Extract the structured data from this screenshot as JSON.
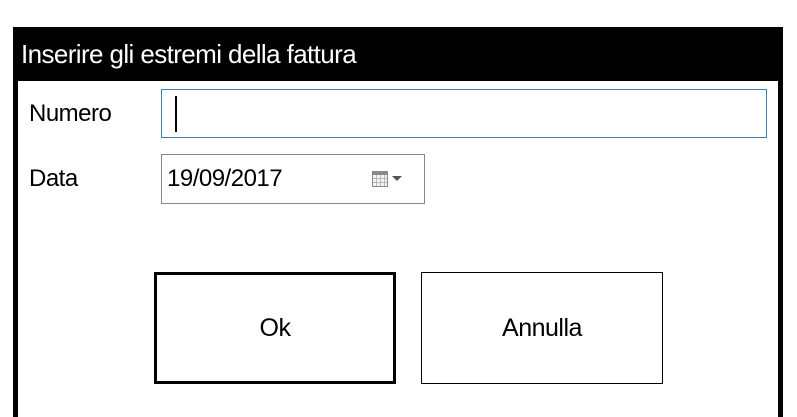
{
  "dialog": {
    "title": "Inserire gli estremi della fattura",
    "fields": {
      "numero": {
        "label": "Numero",
        "value": ""
      },
      "data": {
        "label": "Data",
        "value": "19/09/2017"
      }
    },
    "buttons": {
      "ok": "Ok",
      "cancel": "Annulla"
    }
  },
  "icons": {
    "date_picker": "calendar-icon",
    "dropdown": "chevron-down-icon"
  },
  "colors": {
    "title_bar": "#000000",
    "title_text": "#ffffff",
    "focused_input_border": "#3c7fb1",
    "input_border": "#828790"
  }
}
